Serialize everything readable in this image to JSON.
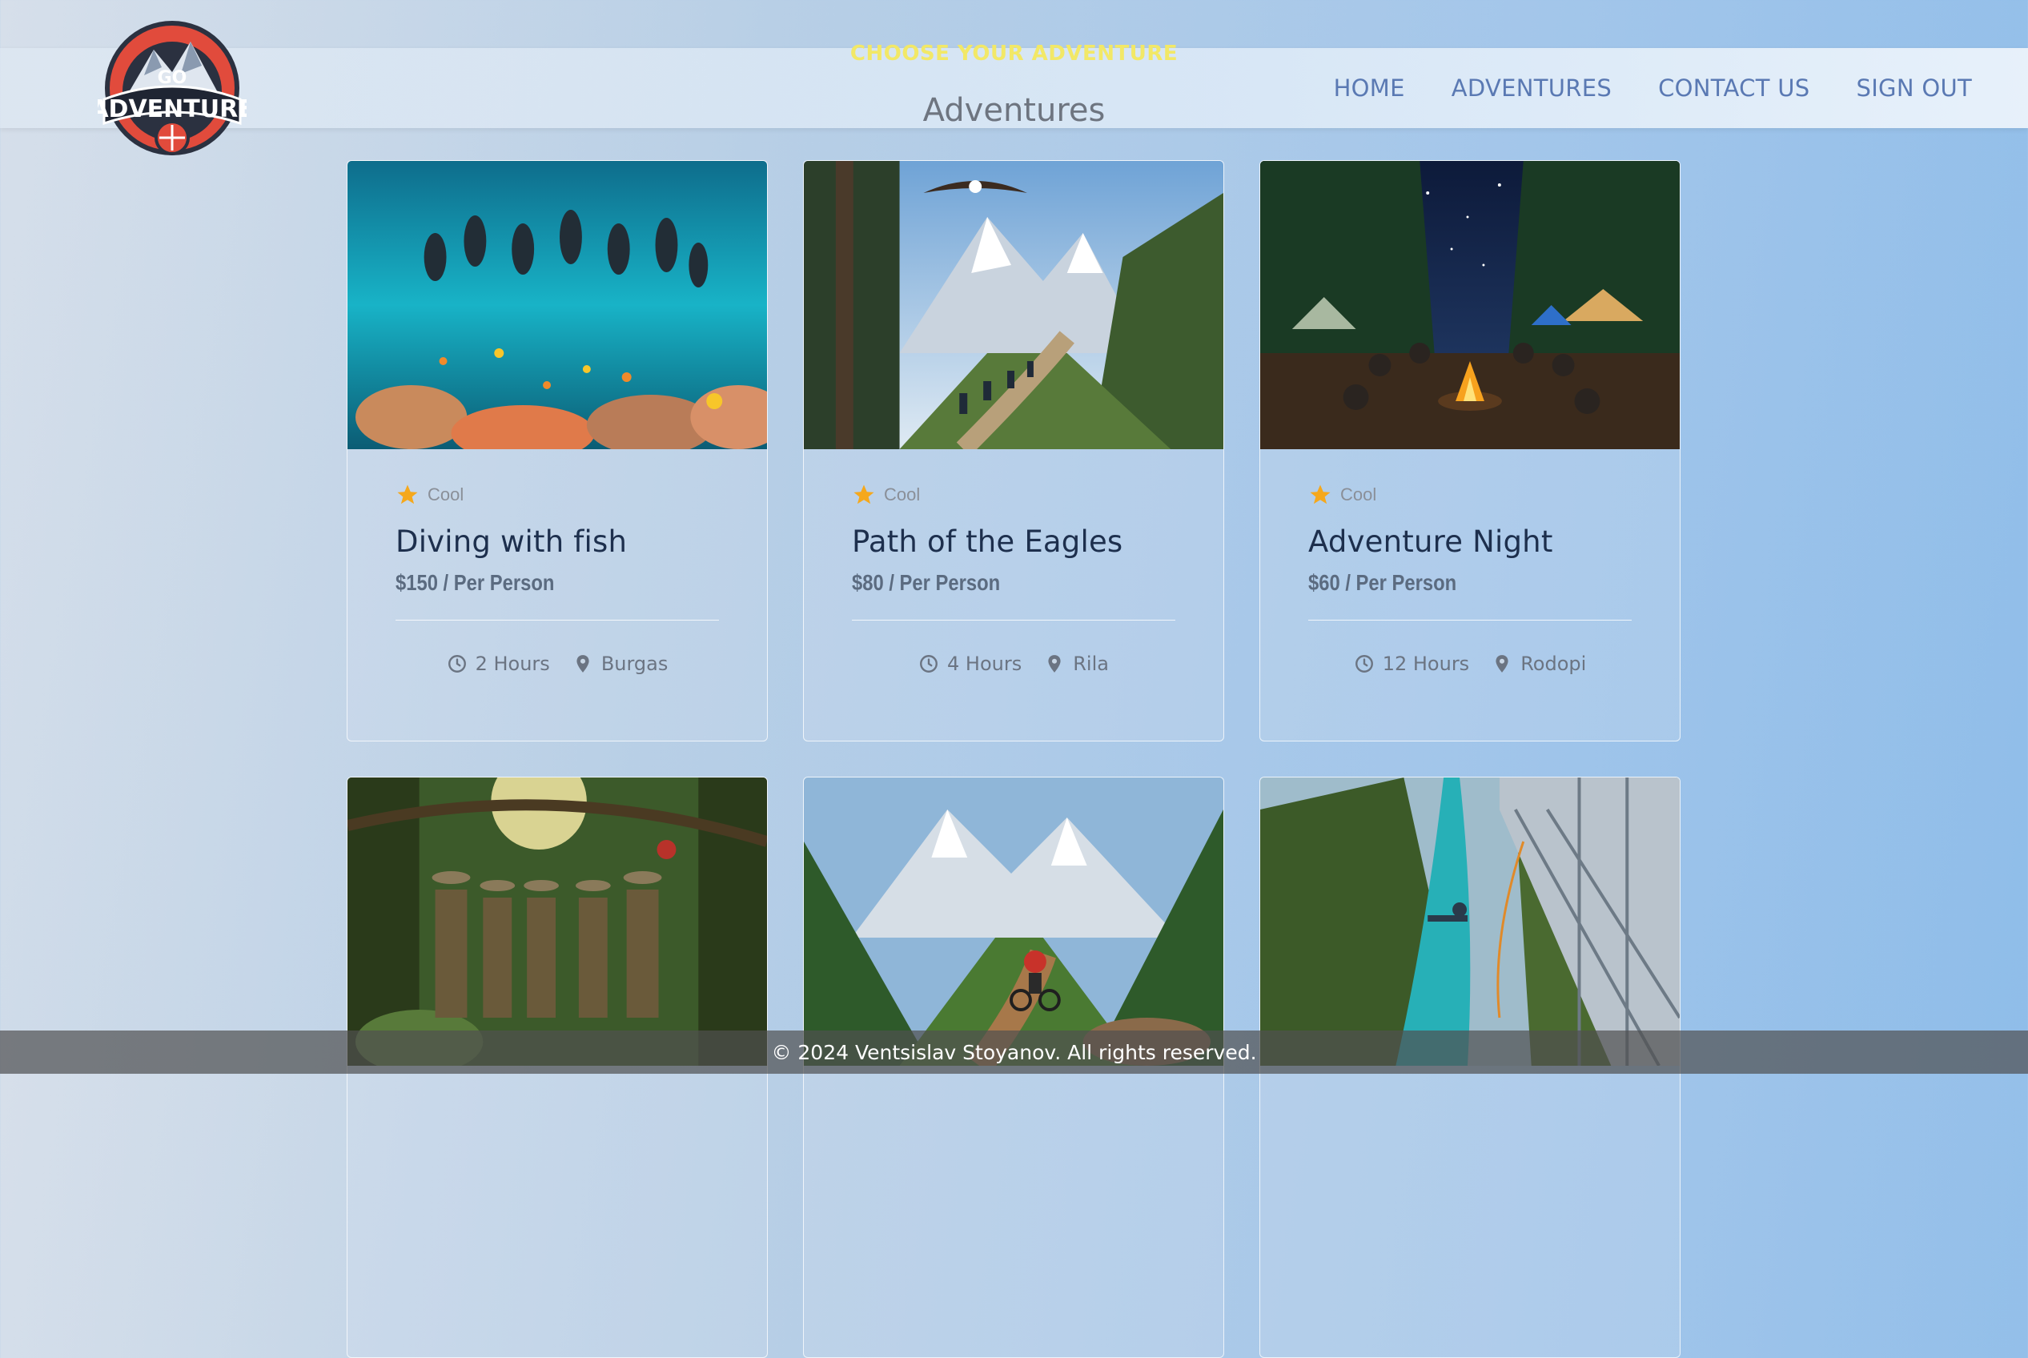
{
  "header": {
    "logo_top": "GO",
    "logo_main": "ADVENTURE",
    "kicker": "CHOOSE YOUR ADVENTURE",
    "title": "Adventures",
    "nav": [
      "HOME",
      "ADVENTURES",
      "CONTACT US",
      "SIGN OUT"
    ]
  },
  "cards": [
    {
      "rating_label": "Cool",
      "title": "Diving with fish",
      "price": "$150 / Per Person",
      "duration": "2 Hours",
      "location": "Burgas",
      "scene": "underwater"
    },
    {
      "rating_label": "Cool",
      "title": "Path of the Eagles",
      "price": "$80 / Per Person",
      "duration": "4 Hours",
      "location": "Rila",
      "scene": "mountain-trail"
    },
    {
      "rating_label": "Cool",
      "title": "Adventure Night",
      "price": "$60 / Per Person",
      "duration": "12 Hours",
      "location": "Rodopi",
      "scene": "campfire"
    },
    {
      "scene": "jungle"
    },
    {
      "scene": "bike"
    },
    {
      "scene": "bungee"
    }
  ],
  "footer": {
    "text": "© 2024 Ventsislav Stoyanov. All rights reserved."
  },
  "colors": {
    "nav": "#5a79b3",
    "kicker": "#f2e867",
    "title_dark": "#1d2f4d",
    "star": "#f5a81c"
  }
}
